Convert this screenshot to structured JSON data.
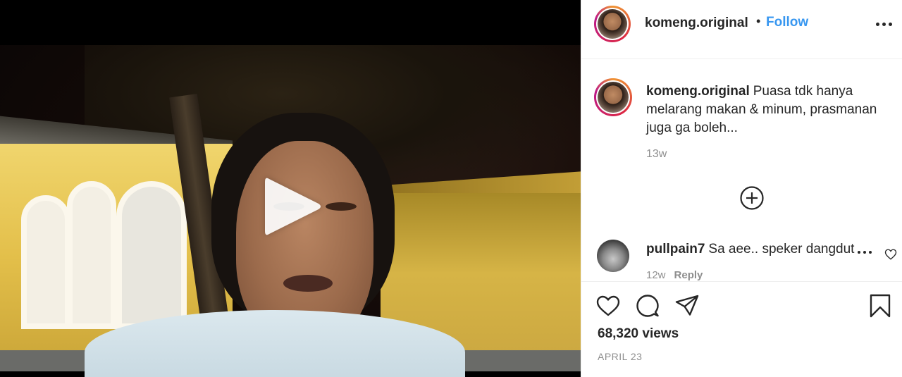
{
  "post": {
    "username": "komeng.original",
    "follow_label": "Follow",
    "dot": "•"
  },
  "caption": {
    "username": "komeng.original",
    "text": "Puasa tdk hanya melarang makan & minum, prasmanan juga ga boleh...",
    "time": "13w"
  },
  "comment": {
    "username": "pullpain7",
    "text": "Sa aee.. speker dangdut",
    "time": "12w",
    "reply_label": "Reply"
  },
  "stats": {
    "views": "68,320 views",
    "date": "APRIL 23"
  },
  "icons": {
    "more": "more-options-icon",
    "play": "play-icon",
    "load_more": "add-circle-icon",
    "like": "heart-icon",
    "comment": "comment-bubble-icon",
    "share": "paper-plane-icon",
    "save": "bookmark-icon"
  },
  "colors": {
    "follow": "#3897f0",
    "muted": "#8e8e8e",
    "text": "#262626",
    "border": "#efefef"
  }
}
